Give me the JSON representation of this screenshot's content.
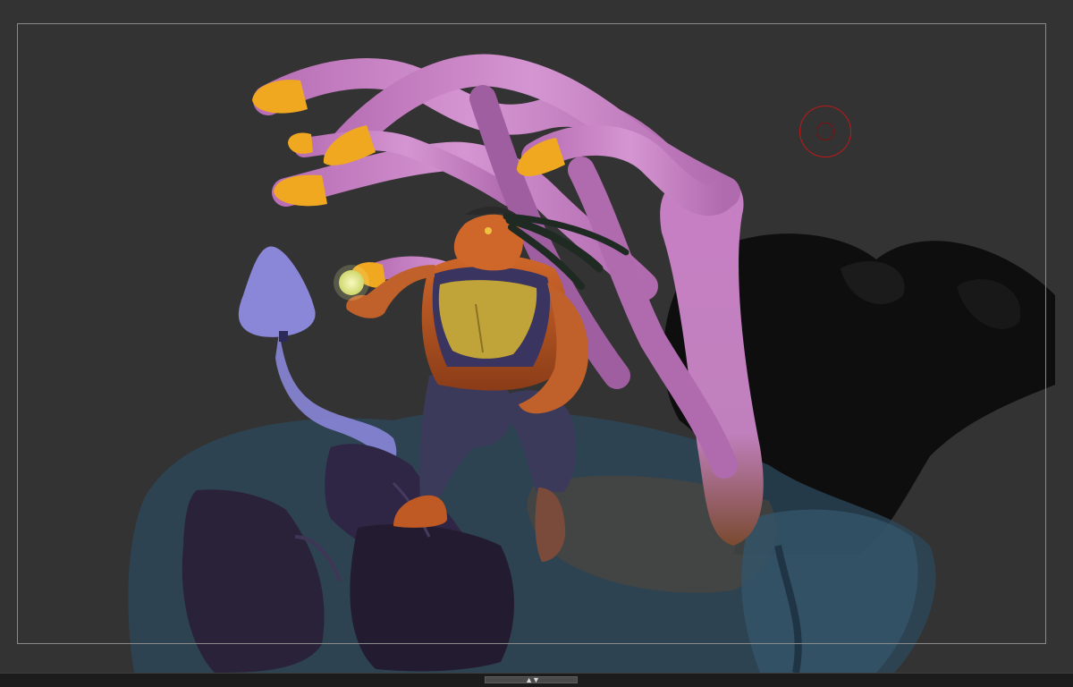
{
  "viewport": {
    "background_color": "#333333",
    "frame_guide_color": "#8a8a8a"
  },
  "scene": {
    "character": "orange-lizard-man",
    "tentacle_color": "#c77fc4",
    "tentacle_tip_color": "#f0a820",
    "mushroom_color": "#8a86d8",
    "rock_color": "#2c2338",
    "base_color": "#2f4a5c",
    "glow_orb_color": "#e8f09a"
  },
  "brush": {
    "icon": "brush-cursor-icon",
    "color": "#c01818"
  },
  "bottom_bar": {
    "handle_icon": "expand-collapse-icon",
    "arrows": "▲▼"
  }
}
